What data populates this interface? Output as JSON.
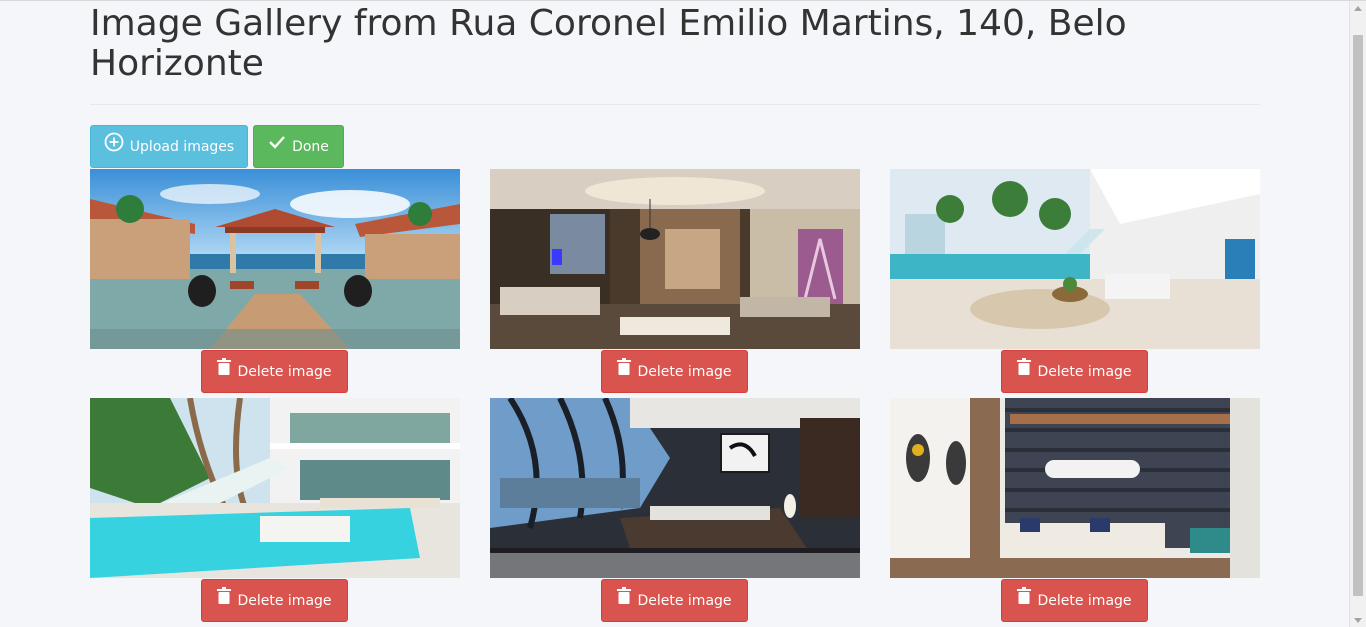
{
  "page": {
    "title": "Image Gallery from Rua Coronel Emilio Martins, 140, Belo Horizonte"
  },
  "toolbar": {
    "upload_label": "Upload images",
    "done_label": "Done"
  },
  "gallery": {
    "images": [
      {
        "name": "gallery-image-1",
        "delete_label": "Delete image"
      },
      {
        "name": "gallery-image-2",
        "delete_label": "Delete image"
      },
      {
        "name": "gallery-image-3",
        "delete_label": "Delete image"
      },
      {
        "name": "gallery-image-4",
        "delete_label": "Delete image"
      },
      {
        "name": "gallery-image-5",
        "delete_label": "Delete image"
      },
      {
        "name": "gallery-image-6",
        "delete_label": "Delete image"
      }
    ]
  },
  "colors": {
    "info": "#5bc0de",
    "success": "#5cb85c",
    "danger": "#d9534f",
    "background": "#f4f6fa"
  },
  "icons": {
    "upload": "plus-circle-icon",
    "done": "check-icon",
    "delete": "trash-icon"
  }
}
